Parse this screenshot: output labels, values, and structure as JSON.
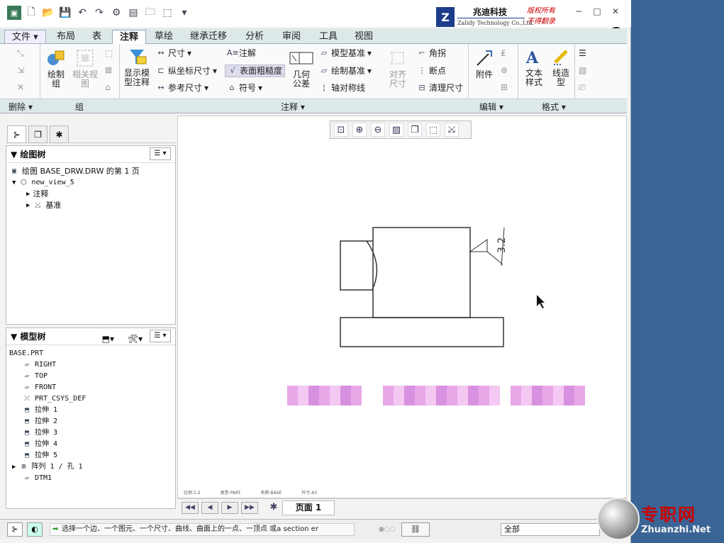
{
  "qa_icons": [
    "app-icon",
    "new-icon",
    "open-icon",
    "save-icon",
    "undo-icon",
    "redo-icon",
    "regenerate-icon",
    "windows-icon",
    "folder-icon",
    "select-icon",
    "more-icon"
  ],
  "logo": {
    "name": "兆迪科技",
    "english": "Zalidy Technology Co.,Ltd.",
    "rights1": "版权所有",
    "rights2": "不得翻录",
    "mark": "Z"
  },
  "window_controls": {
    "minimize": "−",
    "maximize": "□",
    "close": "✕"
  },
  "tabs": [
    "文件",
    "布局",
    "表",
    "注释",
    "草绘",
    "继承迁移",
    "分析",
    "审阅",
    "工具",
    "视图"
  ],
  "active_tab": "注释",
  "ribbon": {
    "delete_label": "删除",
    "group_label": "组",
    "annotate_label": "注释",
    "edit_label": "编辑",
    "format_label": "格式",
    "draw_group": "绘制\n组",
    "related_view": "相关视\n图",
    "show_annotations": "显示模\n型注释",
    "dimension": "尺寸",
    "ordinate_dim": "纵坐标尺寸",
    "ref_dim": "参考尺寸",
    "note": "注解",
    "surface_finish": "表面粗糙度",
    "symbol": "符号",
    "gtol": "几何\n公差",
    "model_datum": "模型基准",
    "draw_datum": "绘制基准",
    "centerline": "轴对称线",
    "align_dim": "对齐\n尺寸",
    "chamfer": "角拐",
    "breakpoint": "断点",
    "cleanup_dim": "清理尺寸",
    "attach": "附件",
    "text_style": "文本\n样式",
    "line_style": "线造\n型"
  },
  "view_toolbar": [
    "refit-icon",
    "zoom-in-icon",
    "zoom-out-icon",
    "repaint-icon",
    "display-style-icon",
    "annotation-display-icon",
    "datum-display-icon"
  ],
  "left_tabs": [
    "model-tree-tab-icon",
    "layers-tab-icon",
    "favorites-tab-icon"
  ],
  "drawing_tree": {
    "title": "绘图树",
    "items": [
      {
        "label": "绘图 BASE_DRW.DRW 的第 1 页",
        "icon": "sheet-icon",
        "indent": 0
      },
      {
        "label": "new_view_5",
        "icon": "view-icon",
        "indent": 1,
        "expander": "▼"
      },
      {
        "label": "注释",
        "icon": "",
        "indent": 2,
        "expander": "▶"
      },
      {
        "label": "基准",
        "icon": "datum-icon",
        "indent": 2,
        "expander": "▶"
      }
    ]
  },
  "model_tree": {
    "title": "模型树",
    "root": "BASE.PRT",
    "items": [
      {
        "label": "RIGHT",
        "icon": "plane-icon"
      },
      {
        "label": "TOP",
        "icon": "plane-icon"
      },
      {
        "label": "FRONT",
        "icon": "plane-icon"
      },
      {
        "label": "PRT_CSYS_DEF",
        "icon": "csys-icon"
      },
      {
        "label": "拉伸 1",
        "icon": "extrude-icon"
      },
      {
        "label": "拉伸 2",
        "icon": "extrude-icon"
      },
      {
        "label": "拉伸 3",
        "icon": "extrude-icon"
      },
      {
        "label": "拉伸 4",
        "icon": "extrude-icon"
      },
      {
        "label": "拉伸 5",
        "icon": "extrude-icon"
      },
      {
        "label": "阵列 1 / 孔 1",
        "icon": "pattern-icon",
        "expander": "▶"
      },
      {
        "label": "DTM1",
        "icon": "plane-icon"
      }
    ]
  },
  "drawing": {
    "roughness_value": "3.2"
  },
  "sheet_info": {
    "scale": "比例:1:2",
    "type": "类型:PART",
    "name": "名称:BASE",
    "size": "尺寸:A3"
  },
  "page_bar": {
    "label": "页面 1"
  },
  "status": {
    "message": "选择一个边、一个图元、一个尺寸、曲线、曲面上的一点、一顶点 或a section er",
    "filter": "全部"
  },
  "watermark": {
    "cn": "专职网",
    "url": "Zhuanzhi.Net"
  }
}
